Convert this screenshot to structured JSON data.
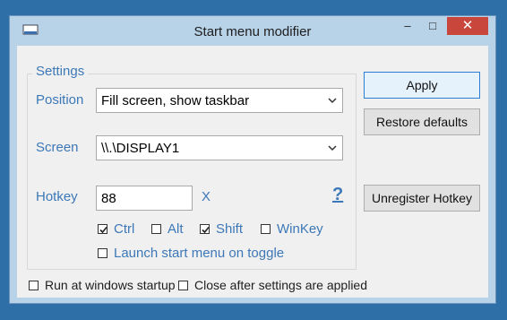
{
  "window": {
    "title": "Start menu modifier",
    "controls": {
      "minimize": "–",
      "maximize": "□",
      "close": "✕"
    }
  },
  "settings": {
    "legend": "Settings",
    "position_label": "Position",
    "position_value": "Fill screen, show taskbar",
    "screen_label": "Screen",
    "screen_value": "\\\\.\\DISPLAY1",
    "hotkey_label": "Hotkey",
    "hotkey_value": "88",
    "hotkey_x": "X",
    "help": "?",
    "modifiers": [
      {
        "label": "Ctrl",
        "checked": true
      },
      {
        "label": "Alt",
        "checked": false
      },
      {
        "label": "Shift",
        "checked": true
      },
      {
        "label": "WinKey",
        "checked": false
      }
    ],
    "launch_on_toggle": {
      "label": "Launch start menu on toggle",
      "checked": false
    }
  },
  "buttons": {
    "apply": "Apply",
    "restore": "Restore defaults",
    "unregister": "Unregister Hotkey"
  },
  "footer": {
    "run_startup": {
      "label": "Run at windows startup",
      "checked": false
    },
    "close_after": {
      "label": "Close after settings are applied",
      "checked": false
    }
  },
  "colors": {
    "accent": "#3c78b8",
    "close": "#c9463d",
    "desktop": "#2f6fa8"
  }
}
